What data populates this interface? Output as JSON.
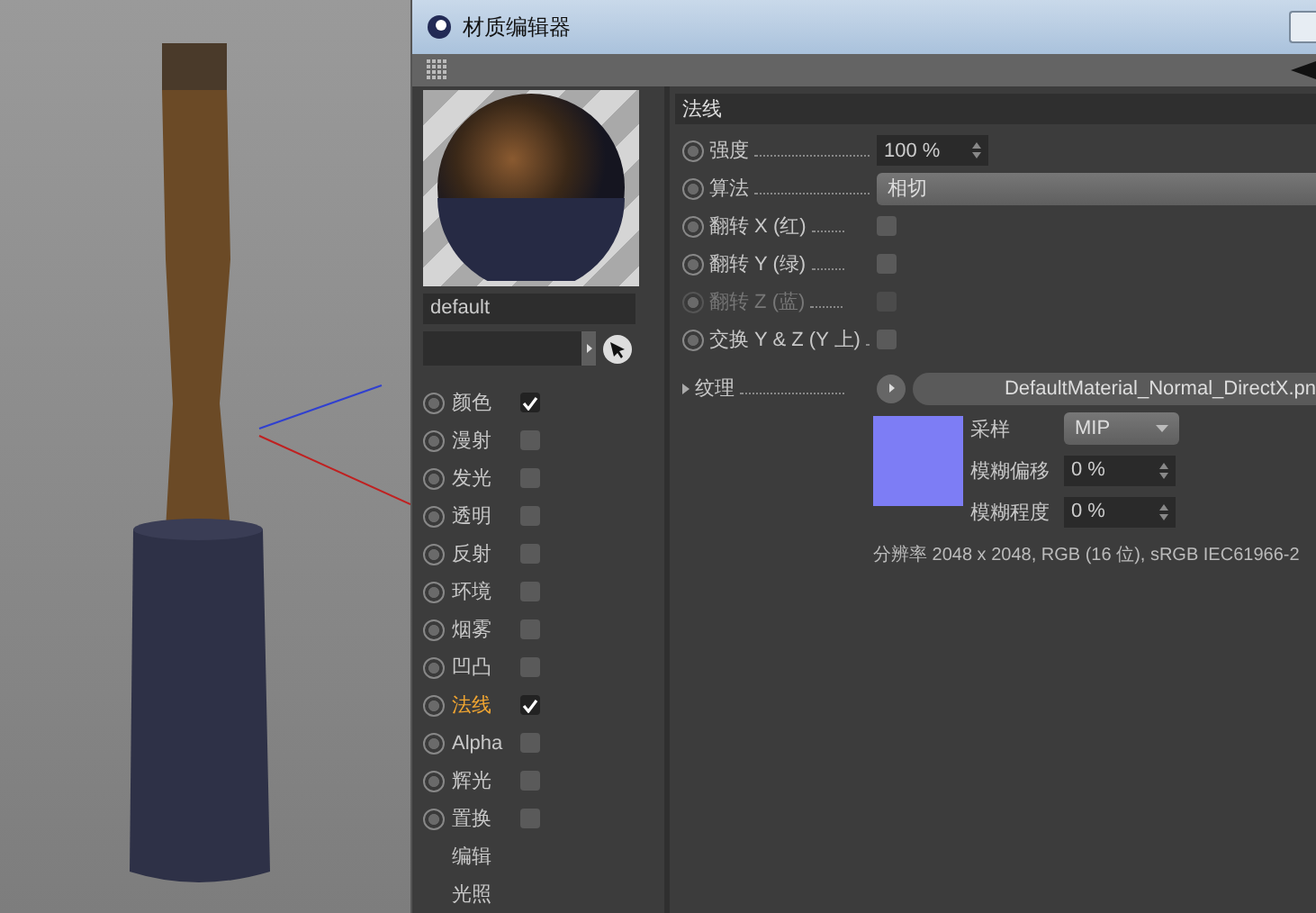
{
  "window": {
    "title": "材质编辑器"
  },
  "material": {
    "name": "default"
  },
  "channels": [
    {
      "kind": "channel",
      "label": "颜色",
      "checked": true,
      "selected": false
    },
    {
      "kind": "channel",
      "label": "漫射",
      "checked": false,
      "selected": false
    },
    {
      "kind": "channel",
      "label": "发光",
      "checked": false,
      "selected": false
    },
    {
      "kind": "channel",
      "label": "透明",
      "checked": false,
      "selected": false
    },
    {
      "kind": "channel",
      "label": "反射",
      "checked": false,
      "selected": false
    },
    {
      "kind": "channel",
      "label": "环境",
      "checked": false,
      "selected": false
    },
    {
      "kind": "channel",
      "label": "烟雾",
      "checked": false,
      "selected": false
    },
    {
      "kind": "channel",
      "label": "凹凸",
      "checked": false,
      "selected": false
    },
    {
      "kind": "channel",
      "label": "法线",
      "checked": true,
      "selected": true
    },
    {
      "kind": "channel",
      "label": "Alpha",
      "checked": false,
      "selected": false
    },
    {
      "kind": "channel",
      "label": "辉光",
      "checked": false,
      "selected": false
    },
    {
      "kind": "channel",
      "label": "置换",
      "checked": false,
      "selected": false
    },
    {
      "kind": "page",
      "label": "编辑"
    },
    {
      "kind": "page",
      "label": "光照"
    }
  ],
  "section": {
    "title": "法线"
  },
  "params": [
    {
      "kind": "number",
      "label": "强度",
      "value": "100 %",
      "disabled": false
    },
    {
      "kind": "dropdown",
      "label": "算法",
      "value": "相切",
      "disabled": false
    },
    {
      "kind": "checkbox",
      "label": "翻转 X (红)",
      "checked": false,
      "disabled": false
    },
    {
      "kind": "checkbox",
      "label": "翻转 Y (绿)",
      "checked": false,
      "disabled": false
    },
    {
      "kind": "checkbox",
      "label": "翻转 Z (蓝)",
      "checked": false,
      "disabled": true
    },
    {
      "kind": "checkbox",
      "label": "交换 Y & Z (Y 上)",
      "checked": false,
      "disabled": false
    }
  ],
  "texture": {
    "label": "纹理",
    "file": "DefaultMaterial_Normal_DirectX.pn",
    "options": [
      {
        "kind": "dropdown",
        "label": "采样",
        "value": "MIP"
      },
      {
        "kind": "number",
        "label": "模糊偏移",
        "value": "0 %"
      },
      {
        "kind": "number",
        "label": "模糊程度",
        "value": "0 %"
      }
    ],
    "info": "分辨率 2048 x 2048, RGB (16 位), sRGB IEC61966-2"
  }
}
